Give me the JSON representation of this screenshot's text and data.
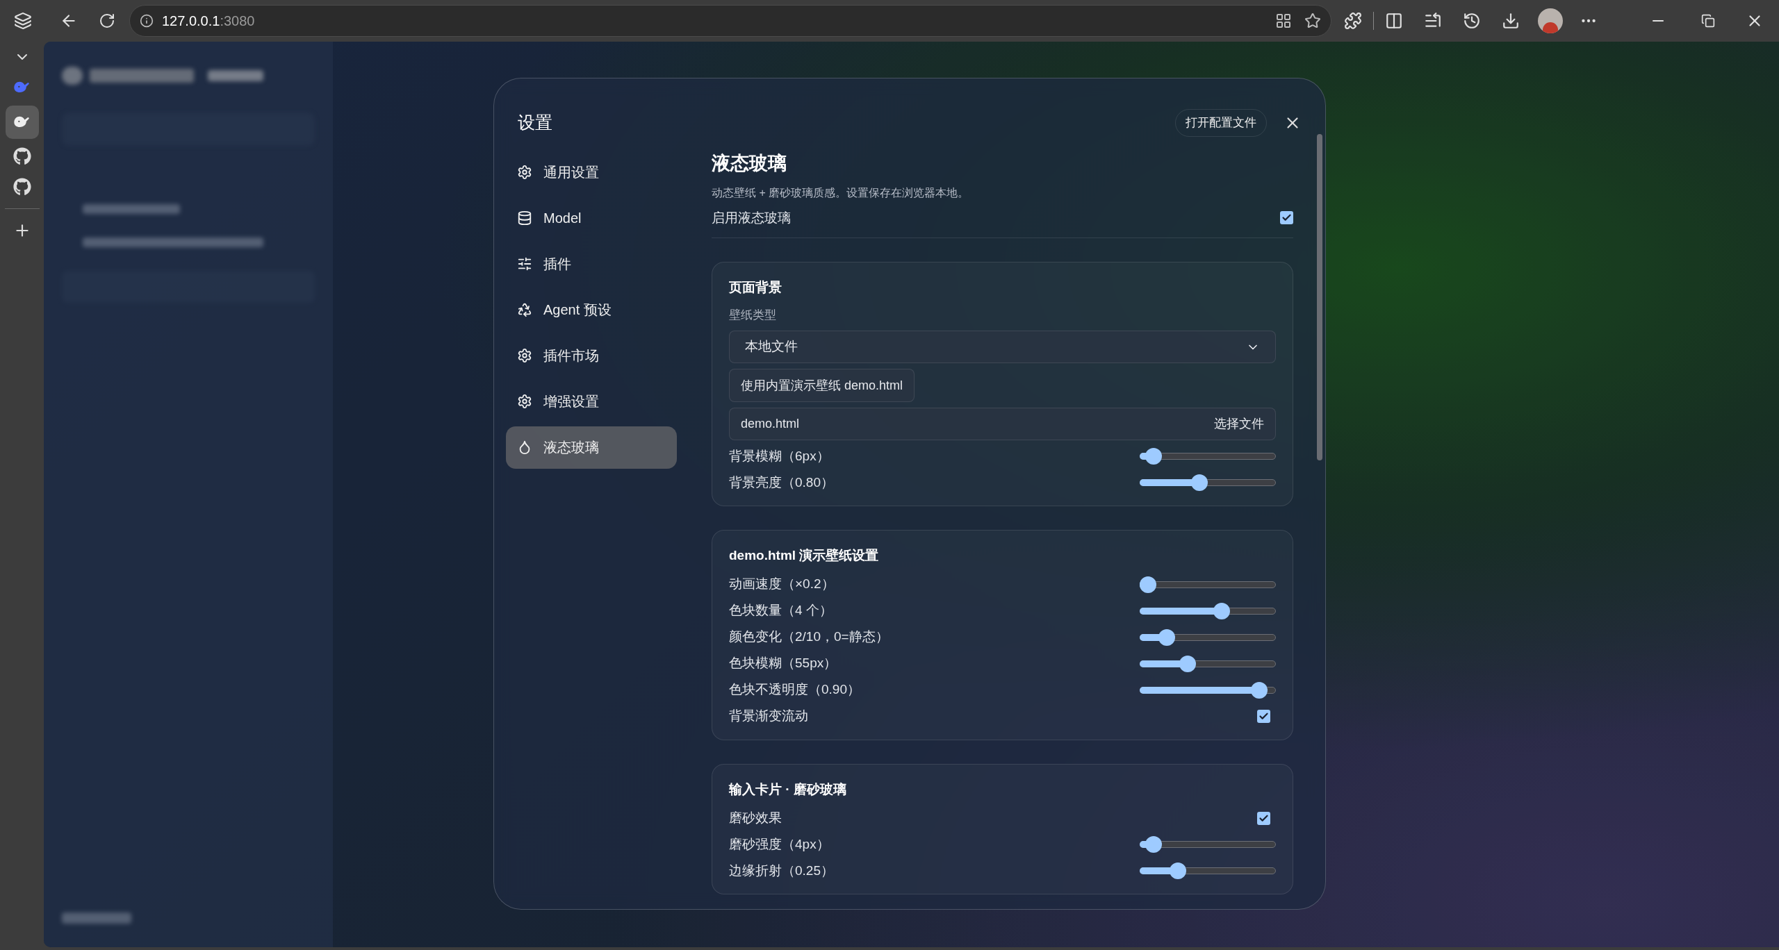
{
  "browser": {
    "host": "127.0.0.1",
    "port": ":3080"
  },
  "modal": {
    "title": "设置",
    "open_config": "打开配置文件",
    "nav": [
      {
        "label": "通用设置",
        "selected": false
      },
      {
        "label": "Model",
        "selected": false
      },
      {
        "label": "插件",
        "selected": false
      },
      {
        "label": "Agent 预设",
        "selected": false
      },
      {
        "label": "插件市场",
        "selected": false
      },
      {
        "label": "增强设置",
        "selected": false
      },
      {
        "label": "液态玻璃",
        "selected": true
      }
    ],
    "section": {
      "title": "液态玻璃",
      "description": "动态壁纸 + 磨砂玻璃质感。设置保存在浏览器本地。",
      "enable": {
        "label": "启用液态玻璃",
        "checked": true
      }
    },
    "groups": [
      {
        "title": "页面背景",
        "rows": [
          {
            "kind": "select",
            "label": "壁纸类型",
            "value": "本地文件"
          },
          {
            "kind": "button",
            "label": "使用内置演示壁纸 demo.html"
          },
          {
            "kind": "file",
            "value": "demo.html",
            "button": "选择文件"
          },
          {
            "kind": "slider",
            "label": "背景模糊（6px）",
            "level": 0.1
          },
          {
            "kind": "slider",
            "label": "背景亮度（0.80）",
            "level": 0.44
          }
        ]
      },
      {
        "title": "demo.html 演示壁纸设置",
        "rows": [
          {
            "kind": "slider",
            "label": "动画速度（×0.2）",
            "level": 0.04
          },
          {
            "kind": "slider",
            "label": "色块数量（4 个）",
            "level": 0.6
          },
          {
            "kind": "slider",
            "label": "颜色变化（2/10，0=静态）",
            "level": 0.2
          },
          {
            "kind": "slider",
            "label": "色块模糊（55px）",
            "level": 0.35
          },
          {
            "kind": "slider",
            "label": "色块不透明度（0.90）",
            "level": 0.88
          },
          {
            "kind": "checkbox",
            "label": "背景渐变流动",
            "checked": true
          }
        ]
      },
      {
        "title": "输入卡片 · 磨砂玻璃",
        "rows": [
          {
            "kind": "checkbox",
            "label": "磨砂效果",
            "checked": true
          },
          {
            "kind": "slider",
            "label": "磨砂强度（4px）",
            "level": 0.1
          },
          {
            "kind": "slider",
            "label": "边缘折射（0.25）",
            "level": 0.28
          }
        ]
      }
    ]
  }
}
